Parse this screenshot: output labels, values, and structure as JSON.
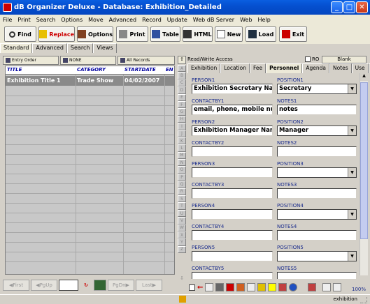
{
  "window": {
    "title": "dB Organizer Deluxe - Database: Exhibition_Detailed"
  },
  "menu": [
    "File",
    "Print",
    "Search",
    "Options",
    "Move",
    "Advanced",
    "Record",
    "Update",
    "Web dB Server",
    "Web",
    "Help"
  ],
  "toolbar": {
    "find": "Find",
    "replace": "Replace",
    "options": "Options",
    "print": "Print",
    "table": "Table",
    "html": "HTML",
    "new": "New",
    "load": "Load",
    "exit": "Exit"
  },
  "view_tabs": [
    "Standard",
    "Advanced",
    "Search",
    "Views"
  ],
  "sort": {
    "entry_order": "Entry Order",
    "none": "NONE",
    "all_records": "All Records"
  },
  "grid": {
    "columns": [
      "TITLE",
      "CATEGORY",
      "STARTDATE",
      "EN"
    ],
    "rows": [
      {
        "title": "Exhibition Title 1",
        "category": "Trade Show",
        "startdate": "04/02/2007"
      }
    ]
  },
  "nav": {
    "first": "First",
    "pgup": "PgUp",
    "pgdn": "PgDn",
    "last": "Last"
  },
  "alphabet": [
    "A",
    "B",
    "C",
    "D",
    "E",
    "F",
    "G",
    "H",
    "I",
    "J",
    "K",
    "L",
    "M",
    "N",
    "O",
    "P",
    "Q",
    "R",
    "S",
    "T",
    "U",
    "V",
    "W",
    "X",
    "Y",
    "Z"
  ],
  "right": {
    "access": "Read/Write Access",
    "ro": "RO",
    "blank": "Blank",
    "tabs": [
      "Exhibition",
      "Location",
      "Fee",
      "Personnel",
      "Agenda",
      "Notes",
      "Use"
    ],
    "fields": {
      "person1_label": "PERSON1",
      "person1": "Exhibition Secretary Name",
      "position1_label": "POSITION1",
      "position1": "Secretary",
      "contactby1_label": "CONTACTBY1",
      "contactby1": "email,  phone, mobile number",
      "notes1_label": "NOTES1",
      "notes1": "notes",
      "person2_label": "PERSON2",
      "person2": "Exhibition Manager Name",
      "position2_label": "POSITION2",
      "position2": "Manager",
      "contactby2_label": "CONTACTBY2",
      "notes2_label": "NOTES2",
      "person3_label": "PERSON3",
      "position3_label": "POSITION3",
      "contactby3_label": "CONTACTBY3",
      "notes3_label": "NOTES3",
      "person4_label": "PERSON4",
      "position4_label": "POSITION4",
      "contactby4_label": "CONTACTBY4",
      "notes4_label": "NOTES4",
      "person5_label": "PERSON5",
      "position5_label": "POSITION5",
      "contactby5_label": "CONTACTBY5",
      "notes5_label": "NOTES5"
    }
  },
  "status": {
    "zoom": "100%",
    "db": "exhibition"
  }
}
